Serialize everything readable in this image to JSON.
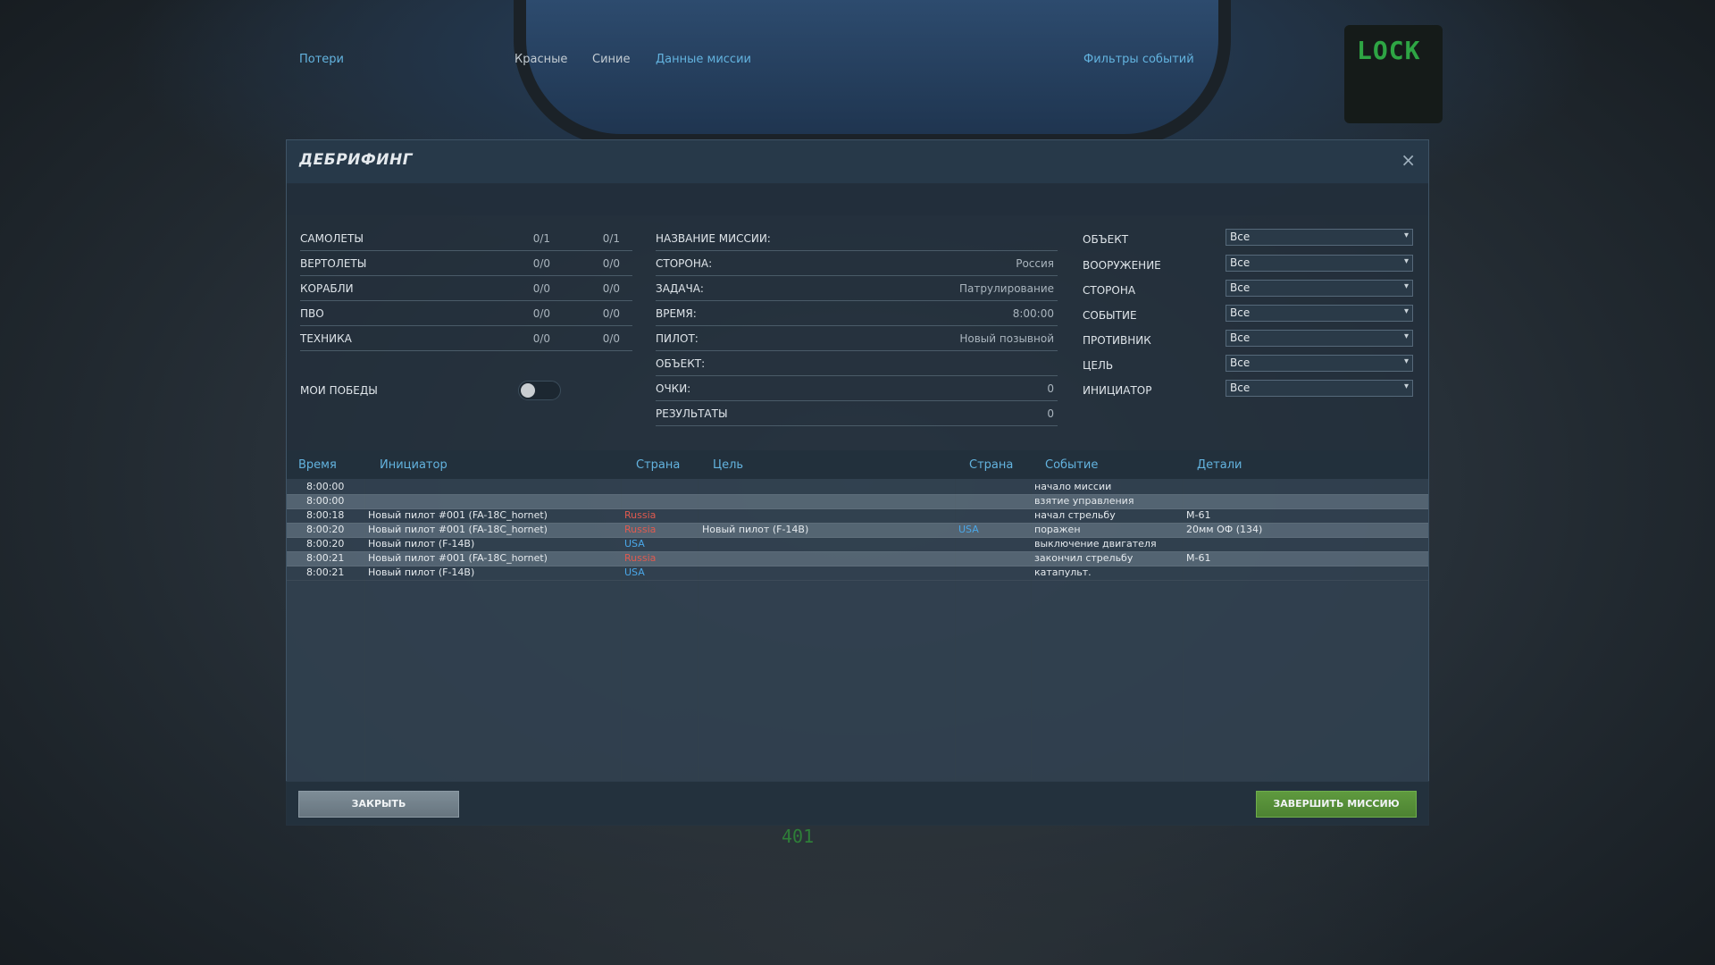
{
  "background": {
    "lock_text": "LOCK",
    "hud_text": "401"
  },
  "dialog": {
    "title": "ДЕБРИФИНГ",
    "close_icon": "×",
    "losses": {
      "header": "Потери",
      "col_red": "Красные",
      "col_blue": "Синие",
      "rows": [
        {
          "label": "САМОЛЕТЫ",
          "red": "0/1",
          "blue": "0/1"
        },
        {
          "label": "ВЕРТОЛЕТЫ",
          "red": "0/0",
          "blue": "0/0"
        },
        {
          "label": "КОРАБЛИ",
          "red": "0/0",
          "blue": "0/0"
        },
        {
          "label": "ПВО",
          "red": "0/0",
          "blue": "0/0"
        },
        {
          "label": "ТЕХНИКА",
          "red": "0/0",
          "blue": "0/0"
        }
      ],
      "my_wins_label": "МОИ ПОБЕДЫ",
      "my_wins_enabled": false
    },
    "mission": {
      "header": "Данные миссии",
      "rows": [
        {
          "label": "НАЗВАНИЕ МИССИИ:",
          "value": ""
        },
        {
          "label": "СТОРОНА:",
          "value": "Россия"
        },
        {
          "label": "ЗАДАЧА:",
          "value": "Патрулирование"
        },
        {
          "label": "ВРЕМЯ:",
          "value": "8:00:00"
        },
        {
          "label": "ПИЛОТ:",
          "value": "Новый позывной"
        },
        {
          "label": "ОБЪЕКТ:",
          "value": ""
        },
        {
          "label": "ОЧКИ:",
          "value": "0"
        },
        {
          "label": "РЕЗУЛЬТАТЫ",
          "value": "0"
        }
      ]
    },
    "filters": {
      "header": "Фильтры событий",
      "rows": [
        {
          "label": "ОБЪЕКТ",
          "value": "Все"
        },
        {
          "label": "ВООРУЖЕНИЕ",
          "value": "Все"
        },
        {
          "label": "СТОРОНА",
          "value": "Все"
        },
        {
          "label": "СОБЫТИЕ",
          "value": "Все"
        },
        {
          "label": "ПРОТИВНИК",
          "value": "Все"
        },
        {
          "label": "ЦЕЛЬ",
          "value": "Все"
        },
        {
          "label": "ИНИЦИАТОР",
          "value": "Все"
        }
      ]
    },
    "events": {
      "columns": [
        "Время",
        "Инициатор",
        "Страна",
        "Цель",
        "Страна",
        "Событие",
        "Детали"
      ],
      "rows": [
        {
          "time": "8:00:00",
          "initiator": "",
          "country": "",
          "target": "",
          "target_country": "",
          "event": "начало миссии",
          "details": ""
        },
        {
          "time": "8:00:00",
          "initiator": "",
          "country": "",
          "target": "",
          "target_country": "",
          "event": "взятие управления",
          "details": ""
        },
        {
          "time": "8:00:18",
          "initiator": "Новый пилот #001 (FA-18C_hornet)",
          "country": "Russia",
          "target": "",
          "target_country": "",
          "event": "начал стрельбу",
          "details": "M-61"
        },
        {
          "time": "8:00:20",
          "initiator": "Новый пилот #001 (FA-18C_hornet)",
          "country": "Russia",
          "target": "Новый пилот (F-14B)",
          "target_country": "USA",
          "event": "поражен",
          "details": "20мм ОФ (134)"
        },
        {
          "time": "8:00:20",
          "initiator": "Новый пилот (F-14B)",
          "country": "USA",
          "target": "",
          "target_country": "",
          "event": "выключение двигателя",
          "details": ""
        },
        {
          "time": "8:00:21",
          "initiator": "Новый пилот #001 (FA-18C_hornet)",
          "country": "Russia",
          "target": "",
          "target_country": "",
          "event": "закончил стрельбу",
          "details": "M-61"
        },
        {
          "time": "8:00:21",
          "initiator": "Новый пилот (F-14B)",
          "country": "USA",
          "target": "",
          "target_country": "",
          "event": "катапульт.",
          "details": ""
        }
      ]
    },
    "buttons": {
      "close": "ЗАКРЫТЬ",
      "finish": "ЗАВЕРШИТЬ МИССИЮ"
    },
    "colors": {
      "accent": "#63b3df",
      "red_side": "#e05a4f",
      "blue_side": "#4aa7e8",
      "finish_button": "#5f9a3f"
    }
  }
}
